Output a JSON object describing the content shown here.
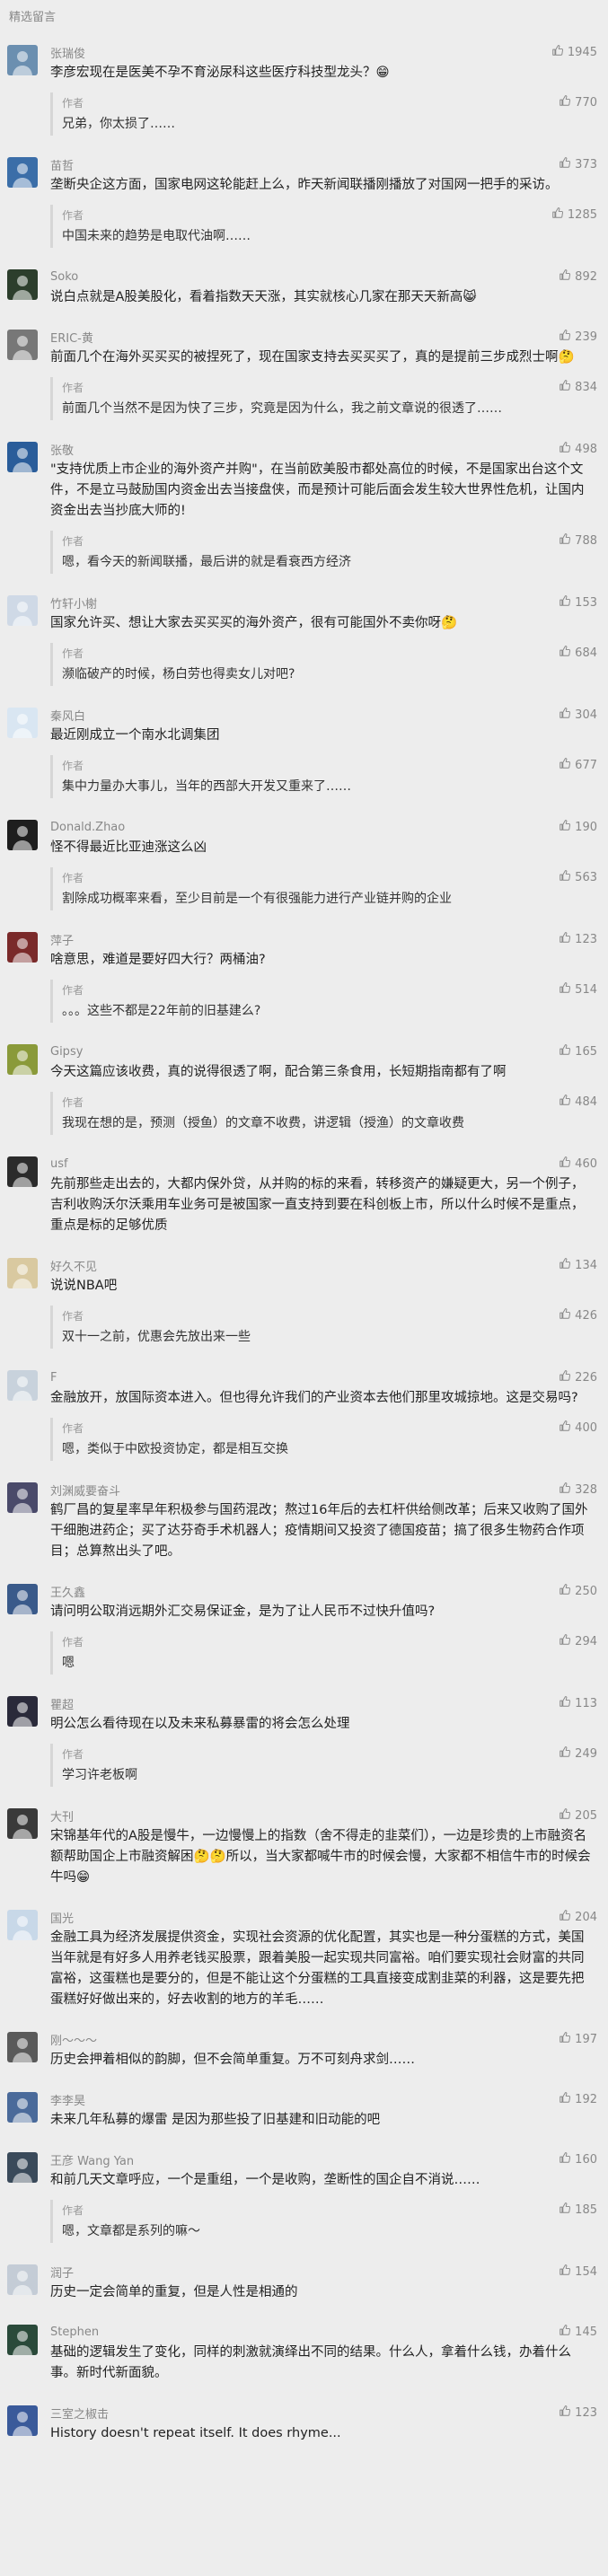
{
  "page": {
    "section_title": "精选留言"
  },
  "comments": [
    {
      "nickname": "张瑞俊",
      "likes": "1945",
      "text": "李彦宏现在是医美不孕不育泌尿科这些医疗科技型龙头？😁",
      "reply": {
        "label": "作者",
        "likes": "770",
        "text": "兄弟，你太损了……"
      },
      "avatar_color": "#6b8fb0"
    },
    {
      "nickname": "苗哲",
      "likes": "373",
      "text": "垄断央企这方面，国家电网这轮能赶上么，昨天新闻联播刚播放了对国网一把手的采访。",
      "reply": {
        "label": "作者",
        "likes": "1285",
        "text": "中国未来的趋势是电取代油啊……"
      },
      "avatar_color": "#3b6ea8"
    },
    {
      "nickname": "Soko",
      "likes": "892",
      "text": "说白点就是A股美股化，看着指数天天涨，其实就核心几家在那天天新高😸",
      "reply": null,
      "avatar_color": "#2c3e2c"
    },
    {
      "nickname": "ERIC-黄",
      "likes": "239",
      "text": "前面几个在海外买买买的被捏死了，现在国家支持去买买买了，真的是提前三步成烈士啊🤔",
      "reply": {
        "label": "作者",
        "likes": "834",
        "text": "前面几个当然不是因为快了三步，究竟是因为什么，我之前文章说的很透了……"
      },
      "avatar_color": "#777777"
    },
    {
      "nickname": "张敬",
      "likes": "498",
      "text": "\"支持优质上市企业的海外资产并购\"，在当前欧美股市都处高位的时候，不是国家出台这个文件，不是立马鼓励国内资金出去当接盘侠，而是预计可能后面会发生较大世界性危机，让国内资金出去当抄底大师的!",
      "reply": {
        "label": "作者",
        "likes": "788",
        "text": "嗯，看今天的新闻联播，最后讲的就是看衰西方经济"
      },
      "avatar_color": "#2a5d9a"
    },
    {
      "nickname": "竹轩小榭",
      "likes": "153",
      "text": "国家允许买、想让大家去买买买的海外资产，很有可能国外不卖你呀🤔",
      "reply": {
        "label": "作者",
        "likes": "684",
        "text": "濒临破产的时候，杨白劳也得卖女儿对吧?"
      },
      "avatar_color": "#cfd9e6"
    },
    {
      "nickname": "秦风白",
      "likes": "304",
      "text": "最近刚成立一个南水北调集团",
      "reply": {
        "label": "作者",
        "likes": "677",
        "text": "集中力量办大事儿，当年的西部大开发又重来了……"
      },
      "avatar_color": "#d9e6f2"
    },
    {
      "nickname": "Donald.Zhao",
      "likes": "190",
      "text": "怪不得最近比亚迪涨这么凶",
      "reply": {
        "label": "作者",
        "likes": "563",
        "text": "割除成功概率来看，至少目前是一个有很强能力进行产业链并购的企业"
      },
      "avatar_color": "#1e1e1e"
    },
    {
      "nickname": "萍子",
      "likes": "123",
      "text": "啥意思，难道是要好四大行？两桶油?",
      "reply": {
        "label": "作者",
        "likes": "514",
        "text": "。。。这些不都是22年前的旧基建么?"
      },
      "avatar_color": "#7a2a2a"
    },
    {
      "nickname": "Gipsy",
      "likes": "165",
      "text": "今天这篇应该收费，真的说得很透了啊，配合第三条食用，长短期指南都有了啊",
      "reply": {
        "label": "作者",
        "likes": "484",
        "text": "我现在想的是，预测（授鱼）的文章不收费，讲逻辑（授渔）的文章收费"
      },
      "avatar_color": "#8a9a3a"
    },
    {
      "nickname": "usf",
      "likes": "460",
      "text": "先前那些走出去的，大都内保外贷，从并购的标的来看，转移资产的嫌疑更大，另一个例子，吉利收购沃尔沃乘用车业务可是被国家一直支持到要在科创板上市，所以什么时候不是重点，重点是标的足够优质",
      "reply": null,
      "avatar_color": "#2b2b2b"
    },
    {
      "nickname": "好久不见",
      "likes": "134",
      "text": "说说NBA吧",
      "reply": {
        "label": "作者",
        "likes": "426",
        "text": "双十一之前，优惠会先放出来一些"
      },
      "avatar_color": "#d9c9a0"
    },
    {
      "nickname": "F",
      "likes": "226",
      "text": "金融放开，放国际资本进入。但也得允许我们的产业资本去他们那里攻城掠地。这是交易吗?",
      "reply": {
        "label": "作者",
        "likes": "400",
        "text": "嗯，类似于中欧投资协定，都是相互交换"
      },
      "avatar_color": "#c8d2dc"
    },
    {
      "nickname": "刘渊威要奋斗",
      "likes": "328",
      "text": "鹤厂昌的复星率早年积极参与国药混改；熬过16年后的去杠杆供给侧改革；后来又收购了国外干细胞进药企；买了达芬奇手术机器人；疫情期间又投资了德国疫苗；搞了很多生物药合作项目；总算熬出头了吧。",
      "reply": null,
      "avatar_color": "#4a4a6a"
    },
    {
      "nickname": "王久鑫",
      "likes": "250",
      "text": "请问明公取消远期外汇交易保证金，是为了让人民币不过快升值吗?",
      "reply": {
        "label": "作者",
        "likes": "294",
        "text": "嗯"
      },
      "avatar_color": "#3a5a8a"
    },
    {
      "nickname": "瞿超",
      "likes": "113",
      "text": "明公怎么看待现在以及未来私募暴雷的将会怎么处理",
      "reply": {
        "label": "作者",
        "likes": "249",
        "text": "学习许老板啊"
      },
      "avatar_color": "#2a2a3a"
    },
    {
      "nickname": "大刊",
      "likes": "205",
      "text": "宋锦基年代的A股是慢牛，一边慢慢上的指数（舍不得走的韭菜们），一边是珍贵的上市融资名额帮助国企上市融资解困🤔🤔所以，当大家都喊牛市的时候会慢，大家都不相信牛市的时候会牛吗😁",
      "reply": null,
      "avatar_color": "#3a3a3a"
    },
    {
      "nickname": "国光",
      "likes": "204",
      "text": "金融工具为经济发展提供资金，实现社会资源的优化配置，其实也是一种分蛋糕的方式，美国当年就是有好多人用养老钱买股票，跟着美股一起实现共同富裕。咱们要实现社会财富的共同富裕，这蛋糕也是要分的，但是不能让这个分蛋糕的工具直接变成割韭菜的利器，这是要先把蛋糕好好做出来的，好去收割的地方的羊毛……",
      "reply": null,
      "avatar_color": "#c8d8e8"
    },
    {
      "nickname": "刚～～～",
      "likes": "197",
      "text": "历史会押着相似的韵脚，但不会简单重复。万不可刻舟求剑……",
      "reply": null,
      "avatar_color": "#5a5a5a"
    },
    {
      "nickname": "李李昊",
      "likes": "192",
      "text": "未来几年私募的爆雷 是因为那些投了旧基建和旧动能的吧",
      "reply": null,
      "avatar_color": "#4a6a9a"
    },
    {
      "nickname": "王彦 Wang Yan",
      "likes": "160",
      "text": "和前几天文章呼应，一个是重组，一个是收购，垄断性的国企自不消说……",
      "reply": {
        "label": "作者",
        "likes": "185",
        "text": "嗯，文章都是系列的嘛～"
      },
      "avatar_color": "#3a4a5a"
    },
    {
      "nickname": "润子",
      "likes": "154",
      "text": "历史一定会简单的重复，但是人性是相通的",
      "reply": null,
      "avatar_color": "#c4ccd6"
    },
    {
      "nickname": "Stephen",
      "likes": "145",
      "text": "基础的逻辑发生了变化，同样的刺激就演绎出不同的结果。什么人，拿着什么钱，办着什么事。新时代新面貌。",
      "reply": null,
      "avatar_color": "#2a4a3a"
    },
    {
      "nickname": "三室之椒击",
      "likes": "123",
      "text": "History doesn't repeat itself. It does rhyme...",
      "reply": null,
      "avatar_color": "#3a5a9a"
    }
  ],
  "icons": {
    "like": "thumbs-up-icon",
    "avatar": "user-avatar"
  }
}
